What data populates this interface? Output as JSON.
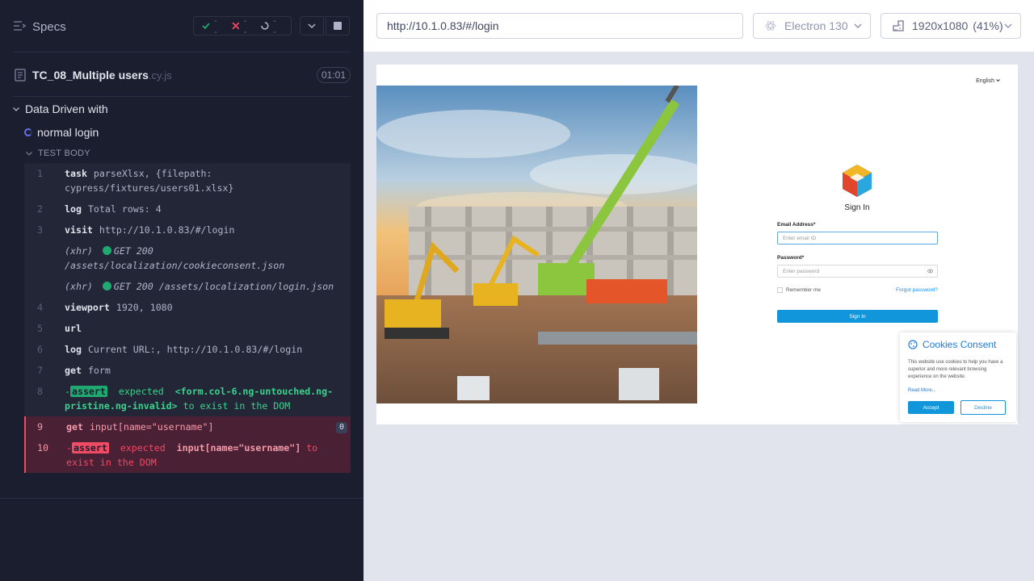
{
  "reporter": {
    "specs_label": "Specs",
    "stats": {
      "passed": "--",
      "failed": "--",
      "pending": "--"
    },
    "spec": {
      "name": "TC_08_Multiple users",
      "ext": ".cy.js",
      "duration": "01:01"
    },
    "suite_title": "Data Driven with",
    "test_title": "normal login",
    "section_label": "TEST BODY",
    "commands": [
      {
        "num": "1",
        "name": "task",
        "msg": "parseXlsx, {filepath: cypress/fixtures/users01.xlsx}"
      },
      {
        "num": "2",
        "name": "log",
        "msg": "Total rows: 4"
      },
      {
        "num": "3",
        "name": "visit",
        "msg": "http://10.1.0.83/#/login"
      },
      {
        "xhr_label": "(xhr)",
        "route": "GET 200 /assets/localization/cookieconsent.json"
      },
      {
        "xhr_label": "(xhr)",
        "route": "GET 200 /assets/localization/login.json"
      },
      {
        "num": "4",
        "name": "viewport",
        "msg": "1920, 1080"
      },
      {
        "num": "5",
        "name": "url",
        "msg": ""
      },
      {
        "num": "6",
        "name": "log",
        "msg": "Current URL:, http://10.1.0.83/#/login"
      },
      {
        "num": "7",
        "name": "get",
        "msg": "form"
      },
      {
        "num": "8",
        "prefix": "-",
        "badge": "assert",
        "word": "expected",
        "subject": "<form.col-6.ng-untouched.ng-pristine.ng-invalid>",
        "tail": "to exist in the DOM"
      },
      {
        "num": "9",
        "name": "get",
        "msg": "input[name=\"username\"]",
        "count": "0"
      },
      {
        "num": "10",
        "prefix": "-",
        "badge": "assert",
        "word": "expected",
        "subject": "input[name=\"username\"]",
        "tail": "to exist in the DOM"
      }
    ]
  },
  "aut": {
    "url": "http://10.1.0.83/#/login",
    "browser": "Electron 130",
    "viewport": "1920x1080",
    "scale": "(41%)",
    "page": {
      "language": "English",
      "title": "Sign In",
      "email_label": "Email Address*",
      "email_placeholder": "Enter email ID",
      "password_label": "Password*",
      "password_placeholder": "Enter password",
      "remember": "Remember me",
      "forgot": "Forgot password?",
      "signin_button": "Sign In"
    },
    "cookies": {
      "title": "Cookies Consent",
      "text": "This website use cookies to help you have a superior and more relevant browsing experience on the website.",
      "read_more": "Read More...",
      "accept": "Accept",
      "decline": "Decline"
    }
  },
  "colors": {
    "pass": "#1fa971",
    "fail": "#f14a65",
    "accent": "#1296db"
  }
}
